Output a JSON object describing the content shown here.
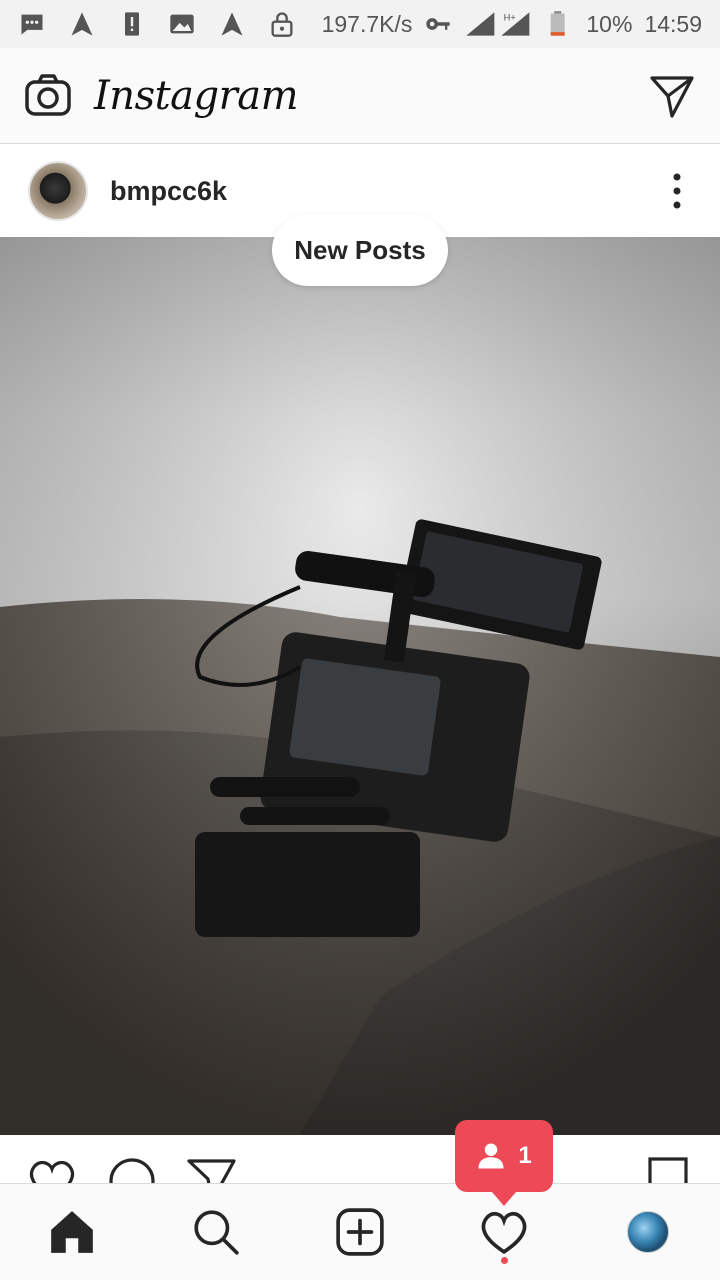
{
  "status_bar": {
    "network_speed": "197.7K/s",
    "network_type": "H+",
    "battery": "10%",
    "time": "14:59",
    "icons": [
      "message-icon",
      "nav-arrow-icon",
      "alert-icon",
      "image-icon",
      "nav-arrow-icon",
      "lock-icon",
      "key-icon",
      "signal-icon",
      "battery-icon"
    ]
  },
  "header": {
    "logo": "Instagram",
    "camera_icon": "camera-icon",
    "direct_icon": "paper-plane-icon"
  },
  "post": {
    "username": "bmpcc6k",
    "more_icon": "more-vertical-icon",
    "photo_alt": "camera rig on rock"
  },
  "new_posts": {
    "label": "New Posts"
  },
  "activity": {
    "count": "1",
    "icon": "person-icon",
    "color": "#ed4956"
  },
  "nav": {
    "items": [
      "home-icon",
      "search-icon",
      "add-icon",
      "heart-icon",
      "profile-avatar"
    ]
  },
  "colors": {
    "accent": "#ed4956",
    "text": "#262626",
    "header_bg": "#fafafa"
  }
}
